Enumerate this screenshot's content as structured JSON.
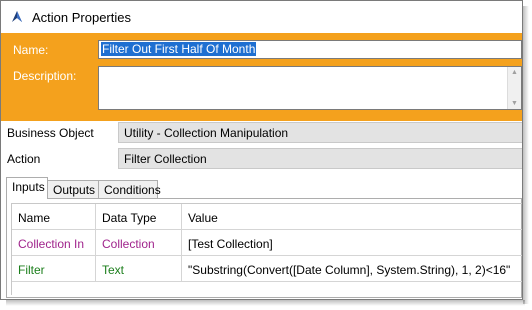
{
  "window": {
    "title": "Action Properties",
    "icon": "action-arrow-icon"
  },
  "colors": {
    "header_band": "#f4a11d",
    "selection": "#1e6fd1",
    "collection_text": "#a0248c",
    "text_type": "#1b7e1b"
  },
  "header": {
    "name_label": "Name:",
    "name_value": "Filter Out First Half Of Month",
    "description_label": "Description:",
    "description_value": ""
  },
  "properties": {
    "business_object_label": "Business Object",
    "business_object_value": "Utility - Collection Manipulation",
    "action_label": "Action",
    "action_value": "Filter Collection"
  },
  "tabs": [
    {
      "label": "Inputs",
      "active": true
    },
    {
      "label": "Outputs",
      "active": false
    },
    {
      "label": "Conditions",
      "active": false
    }
  ],
  "inputs_table": {
    "columns": [
      "Name",
      "Data Type",
      "Value"
    ],
    "rows": [
      {
        "name": "Collection In",
        "data_type": "Collection",
        "value": "[Test Collection]"
      },
      {
        "name": "Filter",
        "data_type": "Text",
        "value": "\"Substring(Convert([Date Column], System.String), 1, 2)<16\""
      }
    ]
  }
}
